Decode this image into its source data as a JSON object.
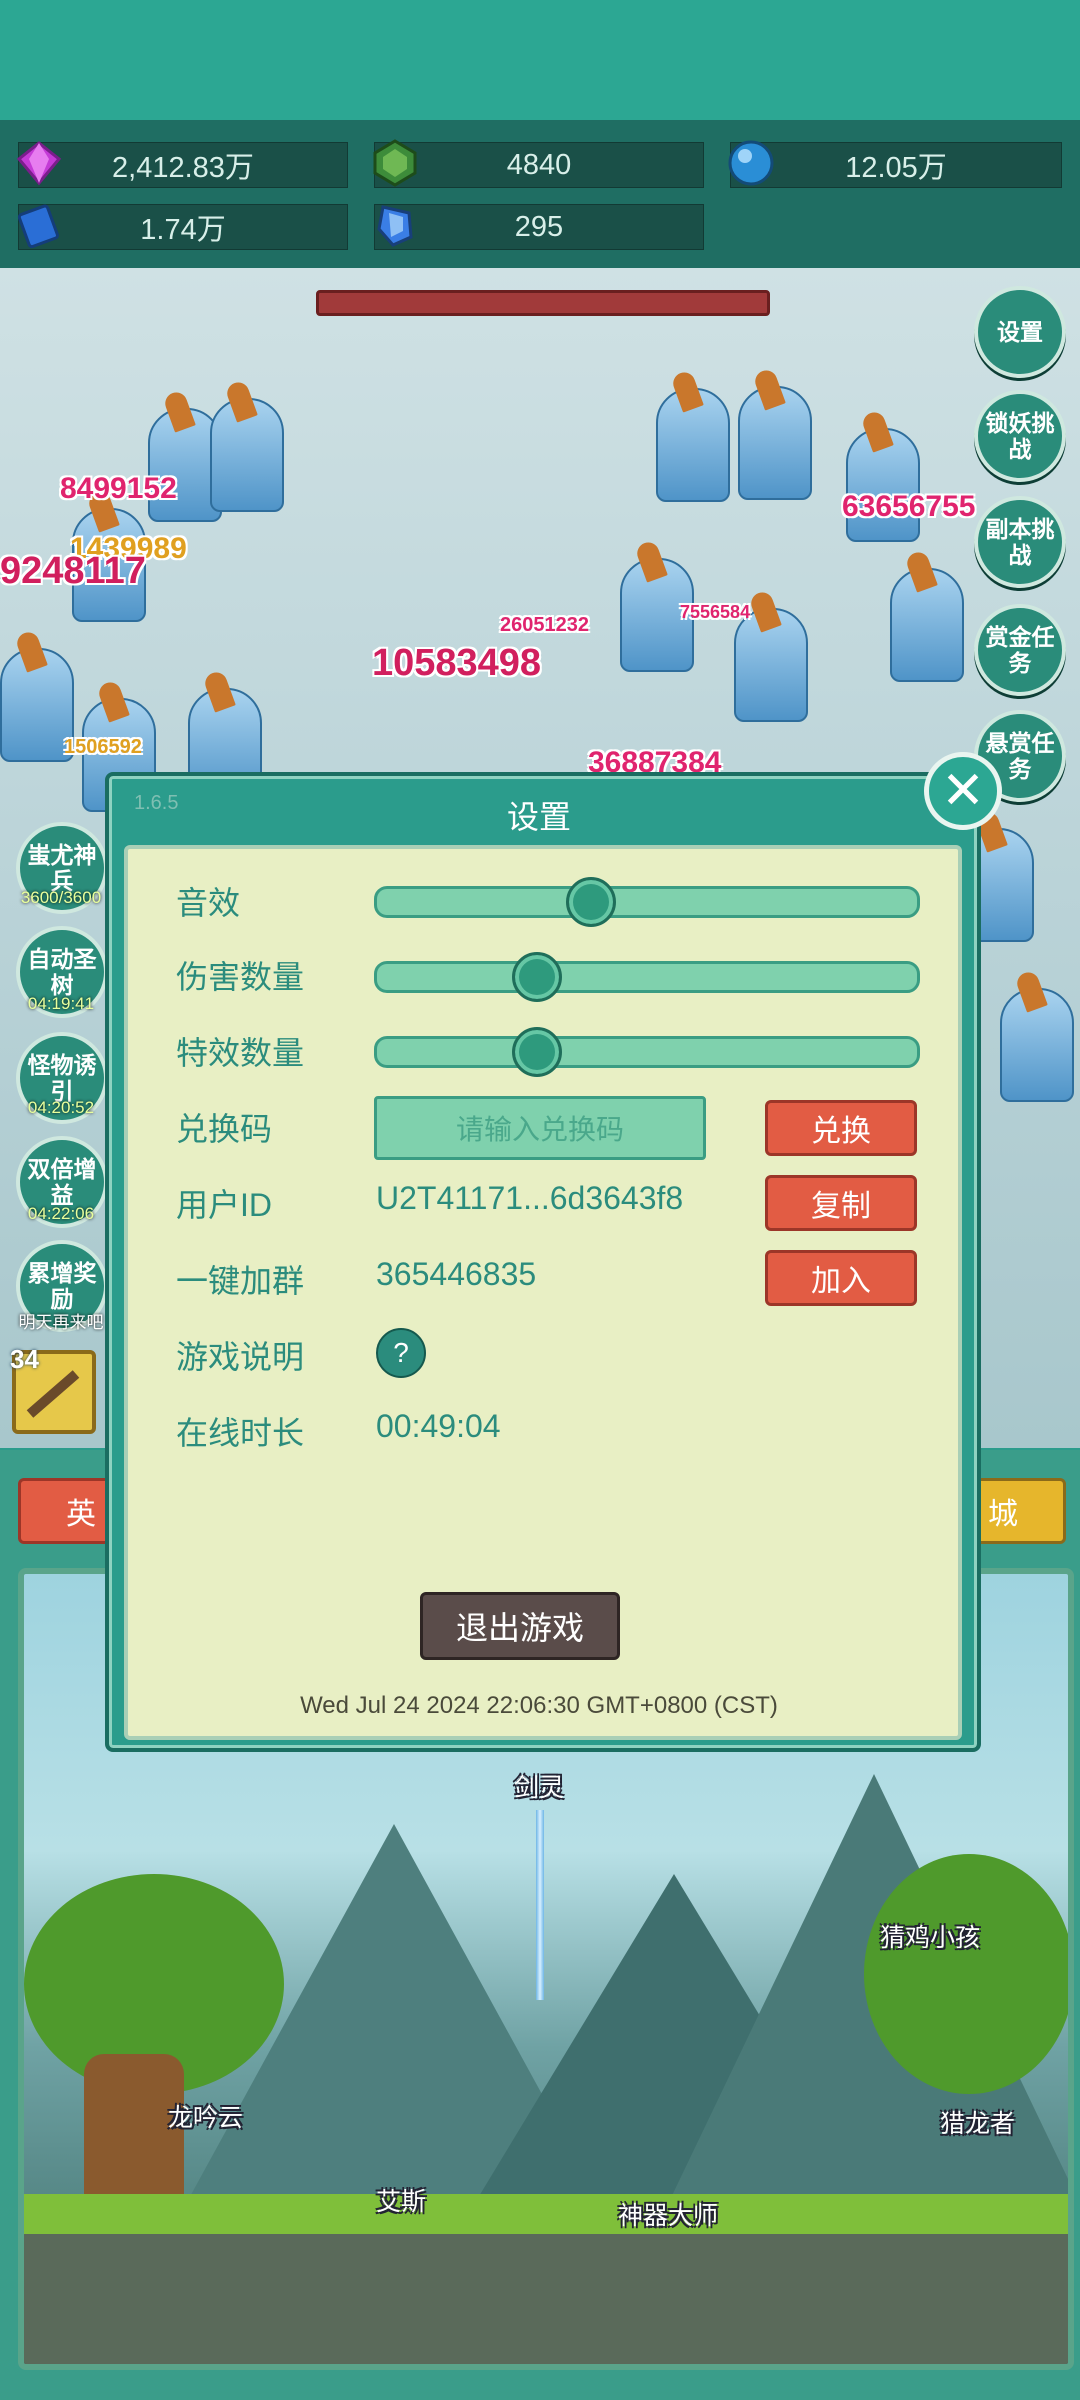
{
  "resources": [
    {
      "icon": "gem-icon",
      "value": "2,412.83万",
      "color": "#c43bd6"
    },
    {
      "icon": "emerald-icon",
      "value": "4840",
      "color": "#3d8c3a"
    },
    {
      "icon": "orb-icon",
      "value": "12.05万",
      "color": "#2a8ed6"
    },
    {
      "icon": "book-icon",
      "value": "1.74万",
      "color": "#2a6ed6"
    },
    {
      "icon": "crystal-icon",
      "value": "295",
      "color": "#3a7ee6"
    }
  ],
  "damage_numbers": [
    "8499152",
    "1439989",
    "9248117",
    "10583498",
    "63656755",
    "1506592",
    "26051232",
    "7556584",
    "36887384"
  ],
  "right_buttons": [
    "设置",
    "锁妖挑战",
    "副本挑战",
    "赏金任务",
    "悬赏任务"
  ],
  "left_buttons": [
    {
      "label": "蚩尤神兵",
      "sub": "3600/3600"
    },
    {
      "label": "自动圣树",
      "sub": "04:19:41"
    },
    {
      "label": "怪物诱引",
      "sub": "04:20:52"
    },
    {
      "label": "双倍增益",
      "sub": "04:22:06"
    },
    {
      "label": "累增奖励",
      "sub": "明天再来吧"
    }
  ],
  "bottom_tabs": {
    "left": "英",
    "right": "城"
  },
  "level_badge": "34",
  "npcs": [
    "剑灵",
    "猜鸡小孩",
    "龙吟云",
    "猎龙者",
    "艾斯",
    "神器大师"
  ],
  "modal": {
    "version": "1.6.5",
    "title": "设置",
    "close": "✕",
    "rows": {
      "sound": "音效",
      "damage_count": "伤害数量",
      "effect_count": "特效数量",
      "redeem_code": "兑换码",
      "redeem_placeholder": "请输入兑换码",
      "redeem_btn": "兑换",
      "user_id_label": "用户ID",
      "user_id": "U2T41171...6d3643f8",
      "copy_btn": "复制",
      "join_group_label": "一键加群",
      "group_id": "365446835",
      "join_btn": "加入",
      "guide_label": "游戏说明",
      "guide_btn": "?",
      "online_label": "在线时长",
      "online_time": "00:49:04"
    },
    "sliders": {
      "sound": 0.39,
      "damage_count": 0.29,
      "effect_count": 0.29
    },
    "exit_btn": "退出游戏",
    "datetime": "Wed Jul 24 2024 22:06:30 GMT+0800 (CST)"
  }
}
